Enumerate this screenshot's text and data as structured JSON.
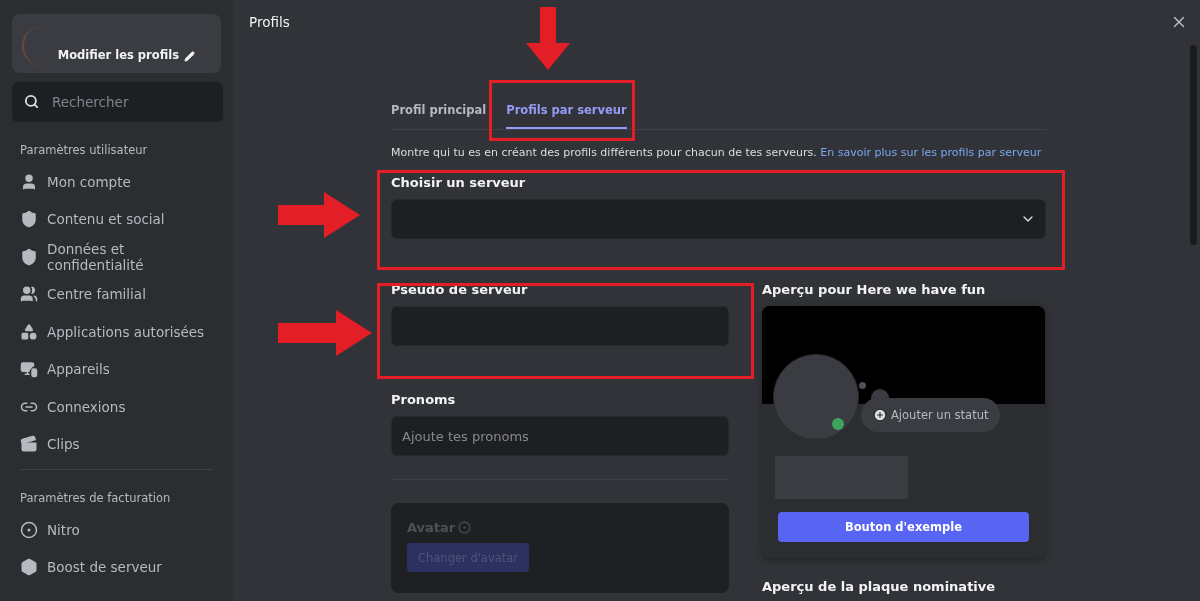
{
  "sidebar": {
    "profile_card": {
      "label": "Modifier les profils"
    },
    "search": {
      "placeholder": "Rechercher"
    },
    "sections": [
      {
        "title": "Paramètres utilisateur",
        "items": [
          {
            "label": "Mon compte",
            "kind": "person"
          },
          {
            "label": "Contenu et social",
            "kind": "shield-person"
          },
          {
            "label": "Données et confidentialité",
            "kind": "shield-lock"
          },
          {
            "label": "Centre familial",
            "kind": "family"
          },
          {
            "label": "Applications autorisées",
            "kind": "apps"
          },
          {
            "label": "Appareils",
            "kind": "devices"
          },
          {
            "label": "Connexions",
            "kind": "link"
          },
          {
            "label": "Clips",
            "kind": "clapper"
          }
        ]
      },
      {
        "title": "Paramètres de facturation",
        "items": [
          {
            "label": "Nitro",
            "kind": "nitro"
          },
          {
            "label": "Boost de serveur",
            "kind": "boost"
          }
        ]
      }
    ]
  },
  "window": {
    "title": "Profils"
  },
  "tabs": [
    {
      "label": "Profil principal",
      "selected": false
    },
    {
      "label": "Profils par serveur",
      "selected": true
    }
  ],
  "description": {
    "text": "Montre qui tu es en créant des profils différents pour chacun de tes serveurs.",
    "link": "En savoir plus sur les profils par serveur"
  },
  "server_select": {
    "label": "Choisir un serveur"
  },
  "nickname": {
    "label": "Pseudo de serveur"
  },
  "pronouns": {
    "label": "Pronoms",
    "placeholder": "Ajoute tes pronoms"
  },
  "avatar": {
    "label": "Avatar",
    "button": "Changer d'avatar"
  },
  "preview": {
    "title": "Aperçu pour Here we have fun",
    "status": "Ajouter un statut",
    "button": "Bouton d'exemple"
  },
  "nameplate": {
    "title": "Aperçu de la plaque nominative"
  }
}
